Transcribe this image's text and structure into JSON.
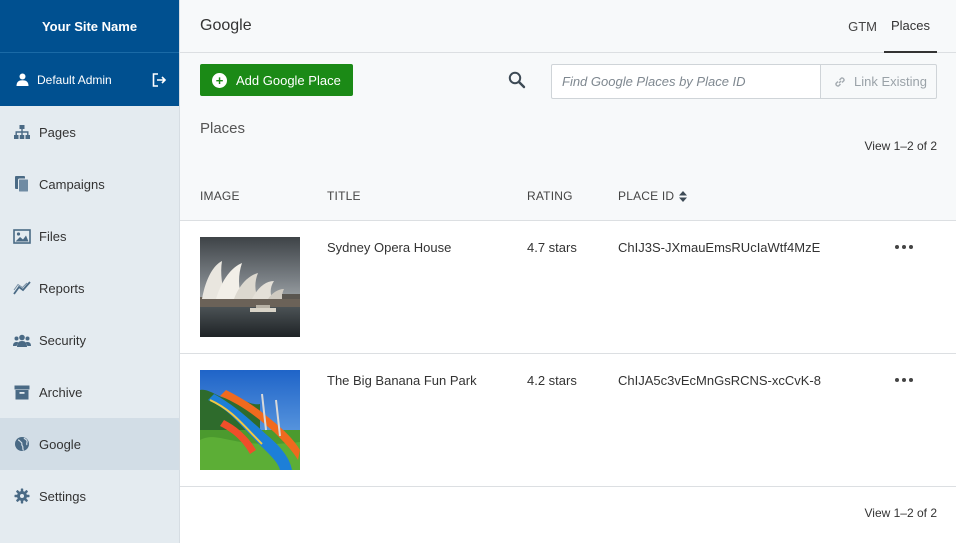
{
  "sidebar": {
    "site_name": "Your Site Name",
    "user": {
      "name": "Default Admin",
      "icon": "user-icon",
      "logout_icon": "logout-icon"
    },
    "items": [
      {
        "label": "Pages",
        "icon": "sitemap-icon"
      },
      {
        "label": "Campaigns",
        "icon": "documents-icon"
      },
      {
        "label": "Files",
        "icon": "image-icon"
      },
      {
        "label": "Reports",
        "icon": "line-chart-icon"
      },
      {
        "label": "Security",
        "icon": "users-icon"
      },
      {
        "label": "Archive",
        "icon": "archive-box-icon"
      },
      {
        "label": "Google",
        "icon": "globe-icon",
        "active": true
      },
      {
        "label": "Settings",
        "icon": "gear-icon"
      }
    ]
  },
  "header": {
    "title": "Google",
    "tabs": [
      {
        "label": "GTM"
      },
      {
        "label": "Places",
        "active": true
      }
    ]
  },
  "toolbar": {
    "add_label": "Add Google Place",
    "search_placeholder": "Find Google Places by Place ID",
    "link_label": "Link Existing"
  },
  "section": {
    "title": "Places",
    "view_count_top": "View 1–2 of 2",
    "view_count_bottom": "View 1–2 of 2"
  },
  "table": {
    "columns": [
      "IMAGE",
      "TITLE",
      "RATING",
      "PLACE ID"
    ],
    "rows": [
      {
        "title": "Sydney Opera House",
        "rating": "4.7 stars",
        "place_id": "ChIJ3S-JXmauEmsRUcIaWtf4MzE",
        "image": "opera-house-photo"
      },
      {
        "title": "The Big Banana Fun Park",
        "rating": "4.2 stars",
        "place_id": "ChIJA5c3vEcMnGsRCNS-xcCvK-8",
        "image": "water-slide-photo"
      }
    ]
  },
  "colors": {
    "brand": "#005090",
    "sidebar_bg": "#e4ebf0",
    "sidebar_active": "#d2dde6",
    "add_button": "#1b8a16"
  }
}
